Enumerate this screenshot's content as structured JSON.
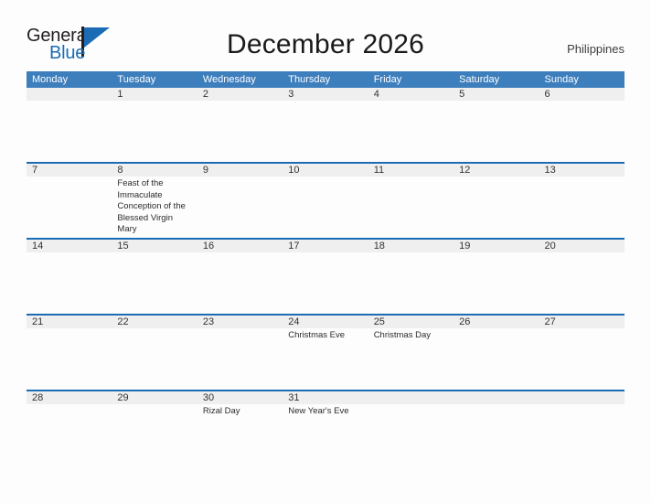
{
  "brand": {
    "name_part1": "General",
    "name_part2": "Blue",
    "flag_icon": "flag-icon"
  },
  "header": {
    "title": "December 2026",
    "region": "Philippines"
  },
  "calendar": {
    "weekday_headers": [
      "Monday",
      "Tuesday",
      "Wednesday",
      "Thursday",
      "Friday",
      "Saturday",
      "Sunday"
    ],
    "weeks": [
      [
        {
          "day": "",
          "events": []
        },
        {
          "day": "1",
          "events": []
        },
        {
          "day": "2",
          "events": []
        },
        {
          "day": "3",
          "events": []
        },
        {
          "day": "4",
          "events": []
        },
        {
          "day": "5",
          "events": []
        },
        {
          "day": "6",
          "events": []
        }
      ],
      [
        {
          "day": "7",
          "events": []
        },
        {
          "day": "8",
          "events": [
            "Feast of the Immaculate Conception of the Blessed Virgin Mary"
          ]
        },
        {
          "day": "9",
          "events": []
        },
        {
          "day": "10",
          "events": []
        },
        {
          "day": "11",
          "events": []
        },
        {
          "day": "12",
          "events": []
        },
        {
          "day": "13",
          "events": []
        }
      ],
      [
        {
          "day": "14",
          "events": []
        },
        {
          "day": "15",
          "events": []
        },
        {
          "day": "16",
          "events": []
        },
        {
          "day": "17",
          "events": []
        },
        {
          "day": "18",
          "events": []
        },
        {
          "day": "19",
          "events": []
        },
        {
          "day": "20",
          "events": []
        }
      ],
      [
        {
          "day": "21",
          "events": []
        },
        {
          "day": "22",
          "events": []
        },
        {
          "day": "23",
          "events": []
        },
        {
          "day": "24",
          "events": [
            "Christmas Eve"
          ]
        },
        {
          "day": "25",
          "events": [
            "Christmas Day"
          ]
        },
        {
          "day": "26",
          "events": []
        },
        {
          "day": "27",
          "events": []
        }
      ],
      [
        {
          "day": "28",
          "events": []
        },
        {
          "day": "29",
          "events": []
        },
        {
          "day": "30",
          "events": [
            "Rizal Day"
          ]
        },
        {
          "day": "31",
          "events": [
            "New Year's Eve"
          ]
        },
        {
          "day": "",
          "events": []
        },
        {
          "day": "",
          "events": []
        },
        {
          "day": "",
          "events": []
        }
      ]
    ]
  },
  "colors": {
    "header_bar": "#3d7ebd",
    "row_separator": "#1b6cb5",
    "date_band": "#efefef",
    "brand_blue": "#1b6cb5",
    "page_background": "#fdfdfd"
  }
}
